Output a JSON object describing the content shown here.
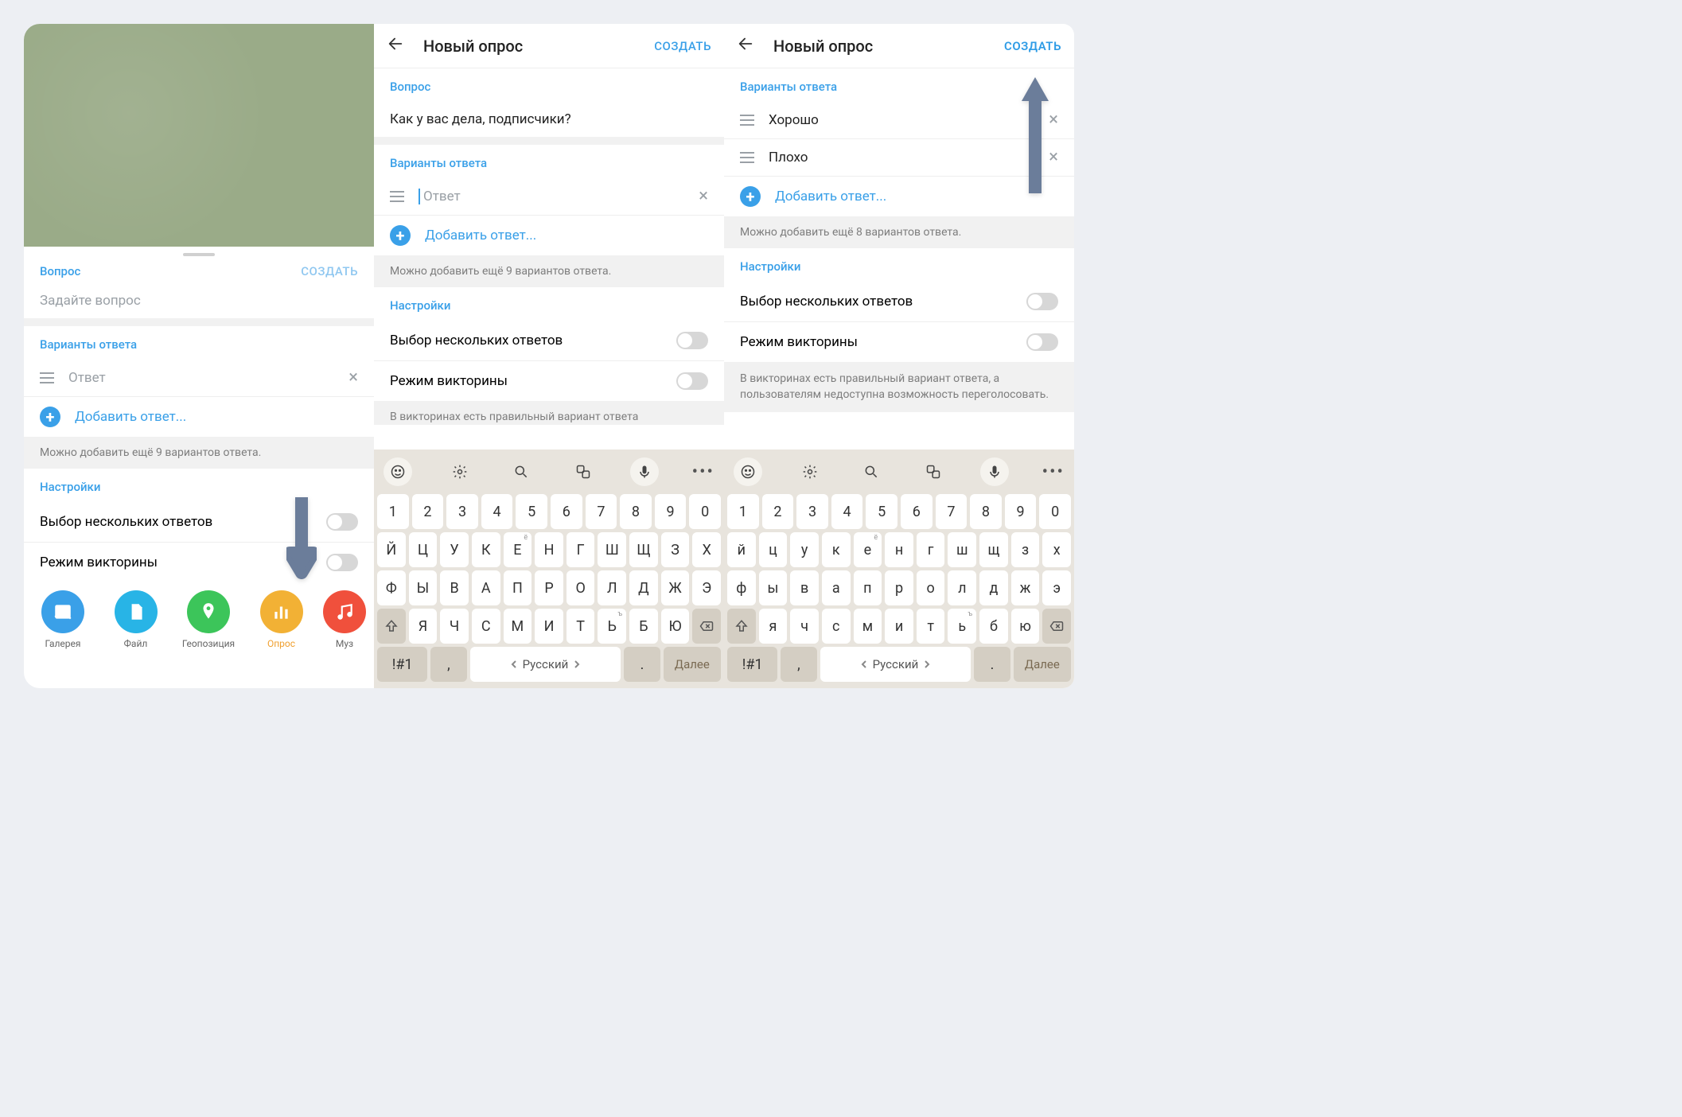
{
  "shared": {
    "new_poll_title": "Новый опрос",
    "create_btn": "СОЗДАТЬ",
    "question_section": "Вопрос",
    "answers_section": "Варианты ответа",
    "answer_placeholder": "Ответ",
    "add_answer": "Добавить ответ...",
    "settings_section": "Настройки",
    "multi_select": "Выбор нескольких ответов",
    "quiz_mode": "Режим викторины"
  },
  "panel1": {
    "question_label": "Вопрос",
    "question_placeholder": "Задайте вопрос",
    "remaining_hint": "Можно добавить ещё 9 вариантов ответа.",
    "attachments": [
      {
        "label": "Галерея",
        "color": "#3aa0e8",
        "icon": "image"
      },
      {
        "label": "Файл",
        "color": "#28b4e6",
        "icon": "file"
      },
      {
        "label": "Геопозиция",
        "color": "#3cc55a",
        "icon": "pin"
      },
      {
        "label": "Опрос",
        "color": "#f2b135",
        "icon": "poll",
        "selected": true
      },
      {
        "label": "Муз",
        "color": "#f0503c",
        "icon": "music",
        "cut": true
      }
    ]
  },
  "panel2": {
    "question_value": "Как у вас дела, подписчики?",
    "remaining_hint": "Можно добавить ещё 9 вариантов ответа.",
    "quiz_hint_partial": "В викторинах есть правильный вариант ответа"
  },
  "panel3": {
    "answers": [
      "Хорошо",
      "Плохо"
    ],
    "remaining_hint": "Можно добавить ещё 8 вариантов ответа.",
    "quiz_hint": "В викторинах есть правильный вариант ответа, а пользователям недоступна возможность переголосовать."
  },
  "keyboard": {
    "row_num": [
      "1",
      "2",
      "3",
      "4",
      "5",
      "6",
      "7",
      "8",
      "9",
      "0"
    ],
    "row1_upper": [
      "Й",
      "Ц",
      "У",
      "К",
      "Е",
      "Н",
      "Г",
      "Ш",
      "Щ",
      "З",
      "Х"
    ],
    "row1_lower": [
      "й",
      "ц",
      "у",
      "к",
      "е",
      "н",
      "г",
      "ш",
      "щ",
      "з",
      "х"
    ],
    "row2_upper": [
      "Ф",
      "Ы",
      "В",
      "А",
      "П",
      "Р",
      "О",
      "Л",
      "Д",
      "Ж",
      "Э"
    ],
    "row2_lower": [
      "ф",
      "ы",
      "в",
      "а",
      "п",
      "р",
      "о",
      "л",
      "д",
      "ж",
      "э"
    ],
    "row3_upper": [
      "Я",
      "Ч",
      "С",
      "М",
      "И",
      "Т",
      "Ь",
      "Б",
      "Ю"
    ],
    "row3_lower": [
      "я",
      "ч",
      "с",
      "м",
      "и",
      "т",
      "ь",
      "б",
      "ю"
    ],
    "sup_e": "ё",
    "sup_hard": "ъ",
    "symkey": "!#1",
    "comma": ",",
    "space": "Русский",
    "period": ".",
    "next": "Далее"
  }
}
